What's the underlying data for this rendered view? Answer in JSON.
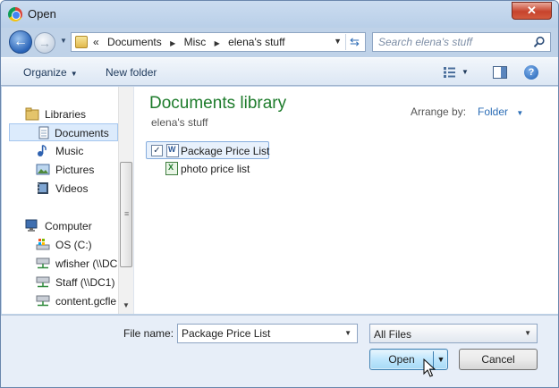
{
  "window": {
    "title": "Open",
    "close_symbol": "✕"
  },
  "nav": {
    "back_symbol": "←",
    "forward_symbol": "→",
    "breadcrumb": [
      "«",
      "Documents",
      "Misc",
      "elena's stuff"
    ],
    "search_placeholder": "Search elena's stuff"
  },
  "toolbar": {
    "organize": "Organize",
    "new_folder": "New folder",
    "help_symbol": "?"
  },
  "navpane": {
    "items": [
      {
        "label": "Libraries",
        "icon": "libraries-icon"
      },
      {
        "label": "Documents",
        "icon": "document-icon"
      },
      {
        "label": "Music",
        "icon": "music-icon"
      },
      {
        "label": "Pictures",
        "icon": "pictures-icon"
      },
      {
        "label": "Videos",
        "icon": "videos-icon"
      },
      {
        "label": "Computer",
        "icon": "computer-icon"
      },
      {
        "label": "OS (C:)",
        "icon": "drive-icon"
      },
      {
        "label": "wfisher (\\\\DC",
        "icon": "network-drive-icon"
      },
      {
        "label": "Staff (\\\\DC1)",
        "icon": "network-drive-icon"
      },
      {
        "label": "content.gcfle",
        "icon": "network-drive-icon"
      }
    ],
    "selected": "Documents"
  },
  "content": {
    "library_title": "Documents library",
    "library_subtitle": "elena's stuff",
    "arrange_label": "Arrange by:",
    "arrange_value": "Folder",
    "files": [
      {
        "name": "Package Price List",
        "type": "word",
        "selected": true,
        "checked": true
      },
      {
        "name": "photo price list",
        "type": "excel",
        "selected": false,
        "checked": false
      }
    ]
  },
  "footer": {
    "file_name_label": "File name:",
    "file_name_value": "Package Price List",
    "file_type_value": "All Files",
    "open_label": "Open",
    "cancel_label": "Cancel"
  },
  "colors": {
    "library_title": "#1e7c2c",
    "link_blue": "#2b6db6",
    "selection": "#dcebfc"
  }
}
